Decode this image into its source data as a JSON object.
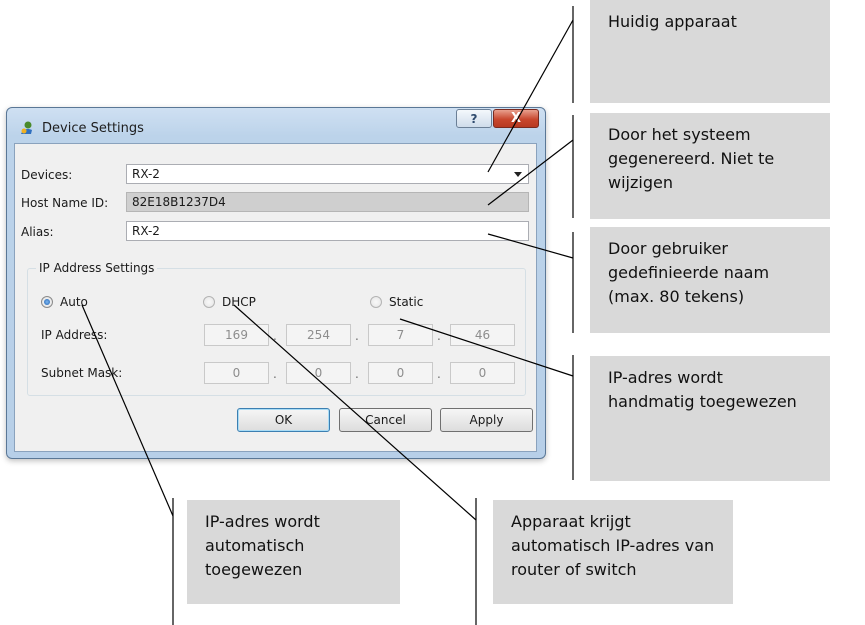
{
  "dialog": {
    "title": "Device Settings",
    "help_label": "?",
    "close_label": "X",
    "devices_label": "Devices:",
    "devices_value": "RX-2",
    "host_label": "Host Name ID:",
    "host_value": "82E18B1237D4",
    "alias_label": "Alias:",
    "alias_value": "RX-2",
    "ip_group": {
      "legend": "IP Address Settings",
      "radios": [
        {
          "label": "Auto",
          "selected": true
        },
        {
          "label": "DHCP",
          "selected": false
        },
        {
          "label": "Static",
          "selected": false
        }
      ],
      "ip_label": "IP Address:",
      "ip_octets": [
        "169",
        "254",
        "7",
        "46"
      ],
      "mask_label": "Subnet Mask:",
      "mask_octets": [
        "0",
        "0",
        "0",
        "0"
      ],
      "separator": "."
    },
    "buttons": {
      "ok": "OK",
      "cancel": "Cancel",
      "apply": "Apply"
    }
  },
  "callouts": {
    "current_device": "Huidig apparaat",
    "system_generated": "Door het systeem gegenereerd. Niet te wijzigen",
    "user_defined": "Door gebruiker gedefinieerde naam (max. 80 tekens)",
    "static_ip": "IP-adres wordt handmatig toegewezen",
    "auto_ip": "IP-adres wordt automatisch toegewezen",
    "dhcp_ip": "Apparaat krijgt automatisch IP-adres van router of switch"
  },
  "colors": {
    "callout_bg": "#d9d9d9",
    "title_bar": "#bcd3ea",
    "close_button": "#c8472e",
    "default_button_border": "#3c7fb1"
  }
}
